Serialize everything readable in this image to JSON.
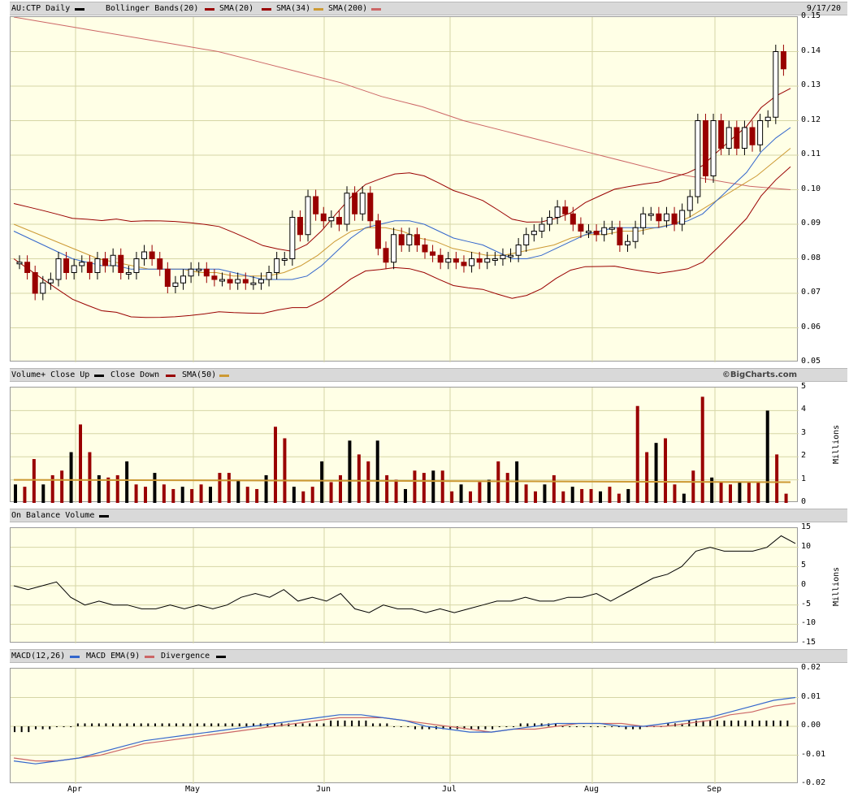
{
  "header": {
    "symbol": "AU:CTP Daily",
    "date": "9/17/20",
    "indicators": [
      "Bollinger Bands(20)",
      "SMA(20)",
      "SMA(34)",
      "SMA(200)"
    ]
  },
  "volume_header": {
    "labels": [
      "Volume+ Close Up",
      "Close Down",
      "SMA(50)"
    ],
    "watermark": "©BigCharts.com"
  },
  "obv_header": {
    "label": "On Balance Volume"
  },
  "macd_header": {
    "labels": [
      "MACD(12,26)",
      "MACD EMA(9)",
      "Divergence"
    ]
  },
  "colors": {
    "up": "#000000",
    "down": "#990000",
    "sma20": "#990000",
    "sma34": "#cc9933",
    "sma200": "#cc6666",
    "bollinger": "#990000",
    "blue": "#3366cc",
    "background": "#ffffe6",
    "grid": "#d6d6a6"
  },
  "x_axis": {
    "months": [
      "Apr",
      "May",
      "Jun",
      "Jul",
      "Aug",
      "Sep"
    ]
  },
  "price_axis": [
    "0.15",
    "0.14",
    "0.13",
    "0.12",
    "0.11",
    "0.10",
    "0.09",
    "0.08",
    "0.07",
    "0.06",
    "0.05"
  ],
  "volume_axis": {
    "ticks": [
      "5",
      "4",
      "3",
      "2",
      "1",
      "0"
    ],
    "unit": "Millions"
  },
  "obv_axis": {
    "ticks": [
      "15",
      "10",
      "5",
      "0",
      "-5",
      "-10",
      "-15"
    ],
    "unit": "Millions"
  },
  "macd_axis": [
    "0.02",
    "0.01",
    "0.00",
    "-0.01",
    "-0.02"
  ],
  "chart_data": [
    {
      "type": "candlestick",
      "title": "AU:CTP Daily",
      "ylim": [
        0.05,
        0.15
      ],
      "x_range": [
        "2020-03-18",
        "2020-09-17"
      ],
      "series": [
        {
          "name": "Price",
          "ohlc_note": "daily candles",
          "close": [
            0.079,
            0.076,
            0.07,
            0.073,
            0.074,
            0.08,
            0.076,
            0.078,
            0.079,
            0.076,
            0.08,
            0.078,
            0.081,
            0.076,
            0.076,
            0.08,
            0.082,
            0.08,
            0.077,
            0.072,
            0.073,
            0.075,
            0.077,
            0.077,
            0.075,
            0.074,
            0.074,
            0.073,
            0.074,
            0.073,
            0.073,
            0.074,
            0.076,
            0.08,
            0.08,
            0.092,
            0.087,
            0.098,
            0.093,
            0.091,
            0.092,
            0.09,
            0.099,
            0.093,
            0.099,
            0.091,
            0.083,
            0.079,
            0.087,
            0.084,
            0.087,
            0.084,
            0.082,
            0.081,
            0.079,
            0.08,
            0.079,
            0.078,
            0.08,
            0.079,
            0.08,
            0.08,
            0.081,
            0.081,
            0.084,
            0.087,
            0.088,
            0.09,
            0.092,
            0.095,
            0.093,
            0.09,
            0.088,
            0.088,
            0.087,
            0.089,
            0.089,
            0.084,
            0.085,
            0.089,
            0.093,
            0.093,
            0.091,
            0.093,
            0.09,
            0.094,
            0.098,
            0.12,
            0.104,
            0.12,
            0.112,
            0.118,
            0.112,
            0.118,
            0.113,
            0.12,
            0.121,
            0.14,
            0.135
          ]
        },
        {
          "name": "SMA(20)",
          "values": [
            0.088,
            0.086,
            0.084,
            0.082,
            0.08,
            0.079,
            0.078,
            0.078,
            0.077,
            0.077,
            0.077,
            0.077,
            0.077,
            0.077,
            0.077,
            0.076,
            0.075,
            0.074,
            0.074,
            0.074,
            0.075,
            0.078,
            0.082,
            0.086,
            0.089,
            0.09,
            0.091,
            0.091,
            0.09,
            0.088,
            0.086,
            0.085,
            0.084,
            0.082,
            0.08,
            0.08,
            0.081,
            0.083,
            0.085,
            0.087,
            0.088,
            0.089,
            0.089,
            0.089,
            0.089,
            0.09,
            0.091,
            0.093,
            0.097,
            0.101,
            0.105,
            0.111,
            0.115,
            0.118
          ]
        },
        {
          "name": "SMA(34)",
          "values": [
            0.09,
            0.088,
            0.086,
            0.084,
            0.082,
            0.08,
            0.079,
            0.078,
            0.077,
            0.077,
            0.077,
            0.076,
            0.076,
            0.075,
            0.075,
            0.075,
            0.076,
            0.078,
            0.081,
            0.085,
            0.088,
            0.089,
            0.089,
            0.088,
            0.086,
            0.085,
            0.083,
            0.082,
            0.081,
            0.081,
            0.082,
            0.083,
            0.084,
            0.086,
            0.087,
            0.087,
            0.088,
            0.088,
            0.089,
            0.09,
            0.092,
            0.095,
            0.098,
            0.101,
            0.104,
            0.108,
            0.112
          ]
        },
        {
          "name": "SMA(200)",
          "values": [
            0.15,
            0.148,
            0.146,
            0.144,
            0.142,
            0.14,
            0.137,
            0.134,
            0.131,
            0.127,
            0.124,
            0.12,
            0.117,
            0.114,
            0.111,
            0.108,
            0.105,
            0.103,
            0.101,
            0.1
          ]
        }
      ]
    },
    {
      "type": "bar",
      "title": "Volume",
      "ylabel": "Millions",
      "ylim": [
        0,
        5
      ],
      "series": [
        {
          "name": "Volume",
          "values": [
            0.8,
            0.7,
            1.9,
            0.8,
            1.2,
            1.4,
            2.2,
            3.4,
            2.2,
            1.2,
            1.1,
            1.2,
            1.8,
            0.8,
            0.7,
            1.3,
            0.8,
            0.6,
            0.7,
            0.6,
            0.8,
            0.7,
            1.3,
            1.3,
            1.0,
            0.7,
            0.6,
            1.2,
            3.3,
            2.8,
            0.7,
            0.5,
            0.7,
            1.8,
            0.9,
            1.2,
            2.7,
            2.1,
            1.8,
            2.7,
            1.2,
            1.0,
            0.6,
            1.4,
            1.3,
            1.4,
            1.4,
            0.5,
            0.8,
            0.5,
            0.9,
            1.0,
            1.8,
            1.3,
            1.8,
            0.8,
            0.5,
            0.8,
            1.2,
            0.5,
            0.7,
            0.6,
            0.6,
            0.5,
            0.7,
            0.4,
            0.6,
            4.2,
            2.2,
            2.6,
            2.8,
            0.8,
            0.4,
            1.4,
            4.6,
            1.1,
            0.9,
            0.8,
            0.9,
            0.9,
            0.9,
            4.0,
            2.1,
            0.4
          ]
        }
      ]
    },
    {
      "type": "line",
      "title": "On Balance Volume",
      "ylabel": "Millions",
      "ylim": [
        -15,
        15
      ],
      "series": [
        {
          "name": "On Balance Volume",
          "values": [
            0,
            -1,
            0,
            1,
            -3,
            -5,
            -4,
            -5,
            -5,
            -6,
            -6,
            -5,
            -6,
            -5,
            -6,
            -5,
            -3,
            -2,
            -3,
            -1,
            -4,
            -3,
            -4,
            -2,
            -6,
            -7,
            -5,
            -6,
            -6,
            -7,
            -6,
            -7,
            -6,
            -5,
            -4,
            -4,
            -3,
            -4,
            -4,
            -3,
            -3,
            -2,
            -4,
            -2,
            0,
            2,
            3,
            5,
            9,
            10,
            9,
            9,
            9,
            10,
            13,
            11
          ]
        }
      ]
    },
    {
      "type": "line",
      "title": "MACD(12,26)",
      "ylim": [
        -0.02,
        0.02
      ],
      "series": [
        {
          "name": "MACD(12,26)",
          "values": [
            -0.012,
            -0.013,
            -0.012,
            -0.011,
            -0.009,
            -0.007,
            -0.005,
            -0.004,
            -0.003,
            -0.002,
            -0.001,
            0.0,
            0.001,
            0.002,
            0.003,
            0.004,
            0.004,
            0.003,
            0.002,
            0.0,
            -0.001,
            -0.002,
            -0.002,
            -0.001,
            0.0,
            0.001,
            0.001,
            0.001,
            0.0,
            0.0,
            0.001,
            0.002,
            0.003,
            0.005,
            0.007,
            0.009,
            0.01
          ]
        },
        {
          "name": "MACD EMA(9)",
          "values": [
            -0.011,
            -0.012,
            -0.012,
            -0.011,
            -0.01,
            -0.008,
            -0.006,
            -0.005,
            -0.004,
            -0.003,
            -0.002,
            -0.001,
            0.0,
            0.001,
            0.002,
            0.003,
            0.003,
            0.003,
            0.002,
            0.001,
            0.0,
            -0.001,
            -0.002,
            -0.001,
            -0.001,
            0.0,
            0.001,
            0.001,
            0.001,
            0.0,
            0.0,
            0.001,
            0.002,
            0.004,
            0.005,
            0.007,
            0.008
          ]
        },
        {
          "name": "Divergence",
          "values": [
            -0.002,
            -0.001,
            0.0,
            0.001,
            0.001,
            0.001,
            0.001,
            0.001,
            0.001,
            0.001,
            0.001,
            0.001,
            0.001,
            0.001,
            0.001,
            0.002,
            0.002,
            0.001,
            0.0,
            -0.001,
            -0.001,
            -0.001,
            -0.001,
            0.0,
            0.001,
            0.001,
            0.0,
            0.0,
            0.0,
            -0.001,
            0.0,
            0.001,
            0.002,
            0.002,
            0.002,
            0.002,
            0.002
          ]
        }
      ]
    }
  ]
}
